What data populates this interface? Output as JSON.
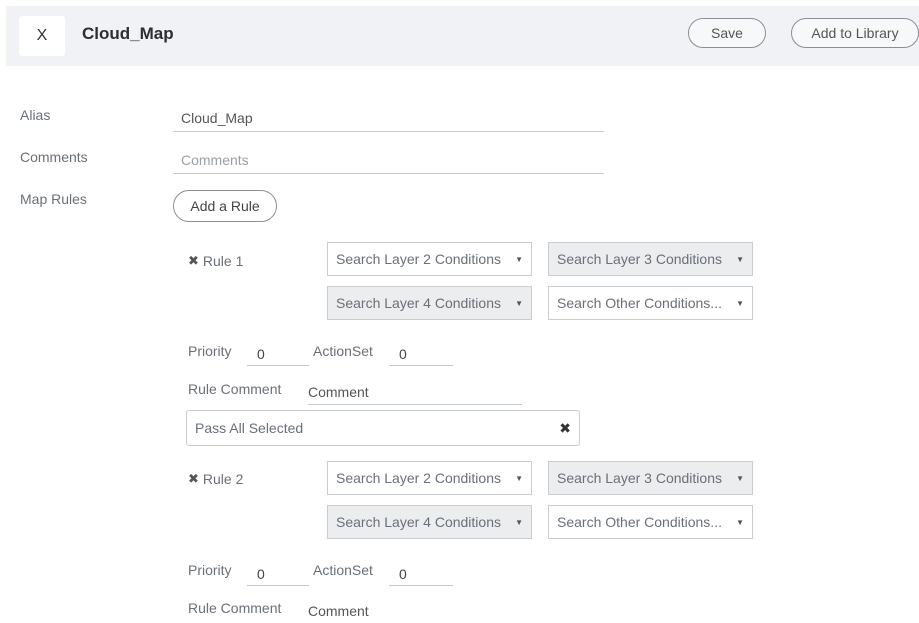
{
  "header": {
    "close_label": "X",
    "title": "Cloud_Map",
    "save_label": "Save",
    "add_to_library_label": "Add to Library"
  },
  "form": {
    "alias_label": "Alias",
    "alias_value": "Cloud_Map",
    "comments_label": "Comments",
    "comments_placeholder": "Comments",
    "map_rules_label": "Map Rules",
    "add_rule_label": "Add a Rule"
  },
  "rules": [
    {
      "remove_icon": "✖",
      "label": "Rule 1",
      "l2": "Search Layer 2 Conditions",
      "l3": "Search Layer 3 Conditions",
      "l4": "Search Layer 4 Conditions",
      "other": "Search Other Conditions...",
      "priority_label": "Priority",
      "priority_value": "0",
      "actionset_label": "ActionSet",
      "actionset_value": "0",
      "comment_label": "Rule Comment",
      "comment_value": "Comment",
      "pass_all": "Pass All Selected",
      "pass_remove_icon": "✖"
    },
    {
      "remove_icon": "✖",
      "label": "Rule 2",
      "l2": "Search Layer 2 Conditions",
      "l3": "Search Layer 3 Conditions",
      "l4": "Search Layer 4 Conditions",
      "other": "Search Other Conditions...",
      "priority_label": "Priority",
      "priority_value": "0",
      "actionset_label": "ActionSet",
      "actionset_value": "0",
      "comment_label": "Rule Comment",
      "comment_value": "Comment"
    }
  ],
  "icons": {
    "caret": "▼"
  }
}
